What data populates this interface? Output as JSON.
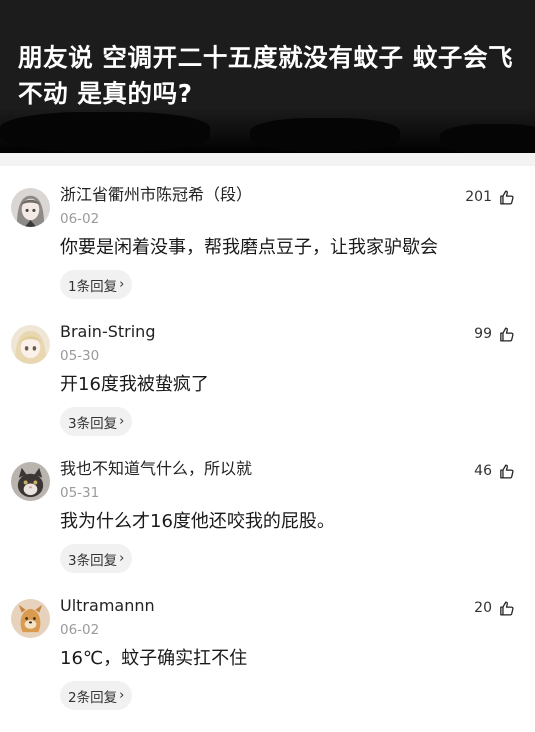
{
  "post": {
    "title": "朋友说 空调开二十五度就没有蚊子 蚊子会飞不动 是真的吗?"
  },
  "comments": [
    {
      "author": "浙江省衢州市陈冠希（段）",
      "date": "06-02",
      "likes": "201",
      "text": "你要是闲着没事，帮我磨点豆子，让我家驴歇会",
      "replies": "1条回复",
      "avatar_icon": "anime-girl-gray-hair-avatar"
    },
    {
      "author": "Brain-String",
      "date": "05-30",
      "likes": "99",
      "text": "开16度我被蛰疯了",
      "replies": "3条回复",
      "avatar_icon": "anime-girl-blonde-avatar"
    },
    {
      "author": "我也不知道气什么，所以就",
      "date": "05-31",
      "likes": "46",
      "text": "我为什么才16度他还咬我的屁股。",
      "replies": "3条回复",
      "avatar_icon": "cat-avatar"
    },
    {
      "author": "Ultramannn",
      "date": "06-02",
      "likes": "20",
      "text": "16℃，蚊子确实扛不住",
      "replies": "2条回复",
      "avatar_icon": "cartoon-dog-avatar"
    }
  ],
  "icons": {
    "like": "thumbs-up-icon",
    "reply_chevron": "chevron-right-icon"
  },
  "colors": {
    "header_bg": "#1c1c1c",
    "title_text": "#ffffff",
    "reply_pill_bg": "#f1f1f1",
    "date_text": "#9a9a9a"
  }
}
